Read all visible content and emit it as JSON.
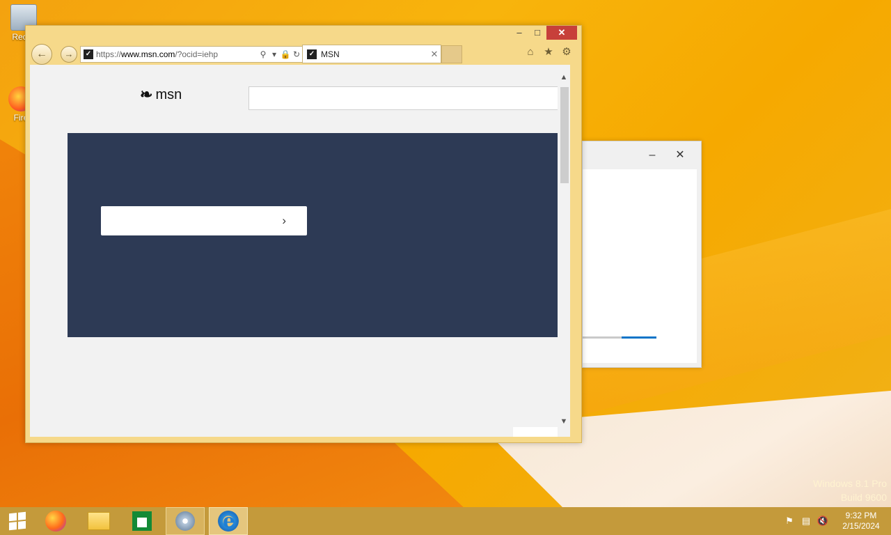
{
  "desktop": {
    "icons": [
      {
        "label": "Recycle Bin",
        "visible": "Recyc"
      },
      {
        "label": "Firefox",
        "visible": "Fire"
      }
    ],
    "watermark": {
      "line1": "Windows 8.1 Pro",
      "line2": "Build 9600"
    }
  },
  "ie": {
    "url_scheme": "https://",
    "url_domain": "www.msn.com",
    "url_rest": "/?ocid=iehp",
    "tab_title": "MSN",
    "caption": {
      "minimize": "–",
      "maximize": "□",
      "close": "✕"
    }
  },
  "page": {
    "logo_text": "msn",
    "search_placeholder": ""
  },
  "backwin": {
    "minimize": "–",
    "close": "✕",
    "progress": 0.47
  },
  "taskbar": {
    "time": "9:32 PM",
    "date": "2/15/2024"
  }
}
